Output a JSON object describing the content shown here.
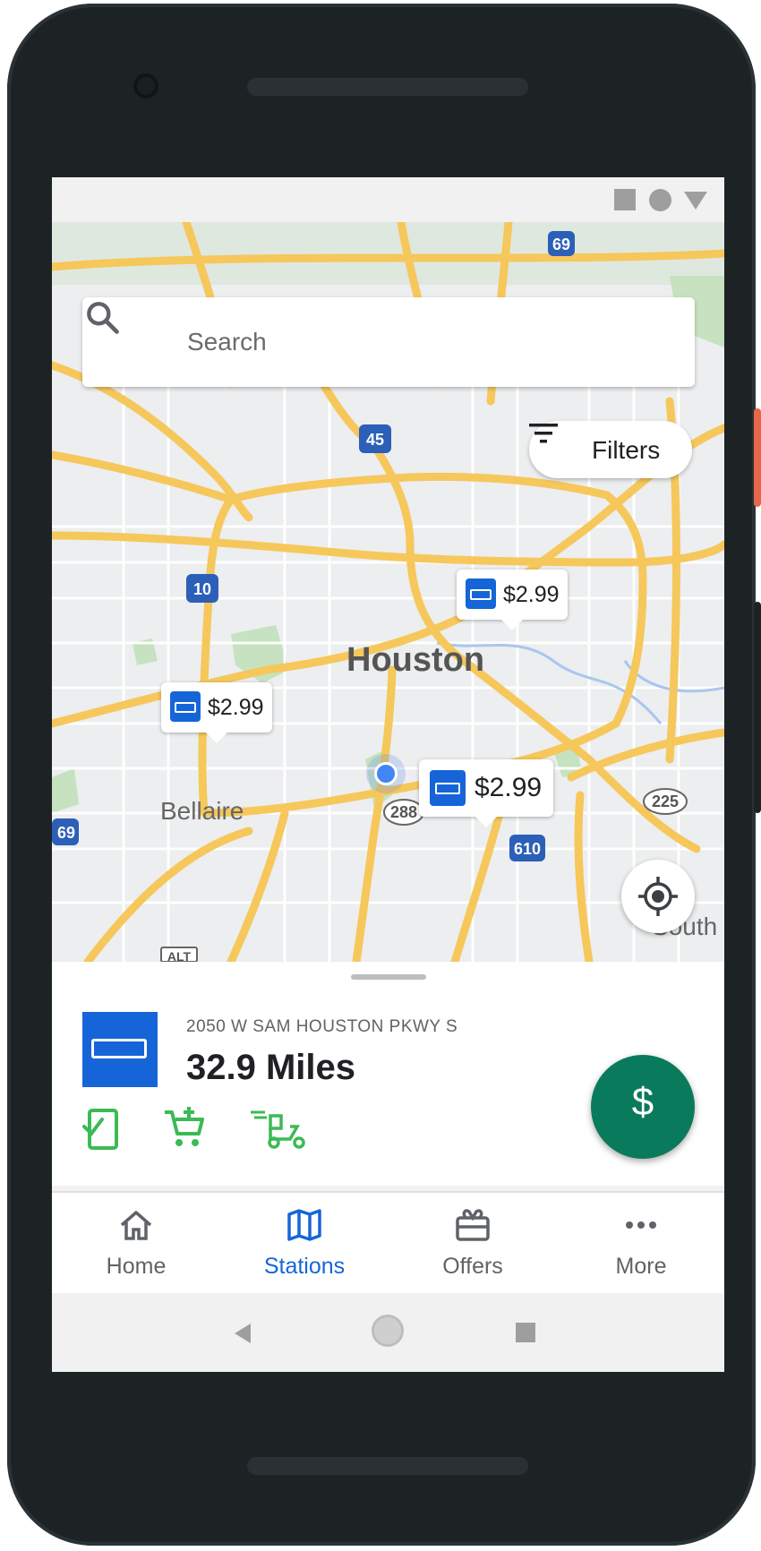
{
  "status_bar": {
    "icons": [
      "square-icon",
      "circle-icon",
      "triangle-icon"
    ]
  },
  "search": {
    "placeholder": "Search"
  },
  "filters": {
    "label": "Filters"
  },
  "map": {
    "city": "Houston",
    "areas": [
      "Bellaire",
      "South"
    ],
    "highway_shields": [
      "69",
      "45",
      "10",
      "288",
      "610",
      "225",
      "69",
      "ALT"
    ],
    "price_pins": [
      {
        "price": "$2.99"
      },
      {
        "price": "$2.99"
      },
      {
        "price": "$2.99"
      }
    ]
  },
  "station": {
    "address": "2050 W SAM HOUSTON PKWY S",
    "distance": "32.9 Miles",
    "amenities": [
      "mobile-pay-icon",
      "add-to-cart-icon",
      "delivery-icon"
    ]
  },
  "fab": {
    "label": "$"
  },
  "nav": {
    "items": [
      {
        "label": "Home",
        "icon": "home-icon"
      },
      {
        "label": "Stations",
        "icon": "map-icon"
      },
      {
        "label": "Offers",
        "icon": "gift-icon"
      },
      {
        "label": "More",
        "icon": "more-icon"
      }
    ],
    "active": "Stations"
  },
  "colors": {
    "brand_blue": "#1665d8",
    "fab_green": "#0a7a5c",
    "amenity_green": "#3cba54",
    "road_yellow": "#f6c75b"
  }
}
